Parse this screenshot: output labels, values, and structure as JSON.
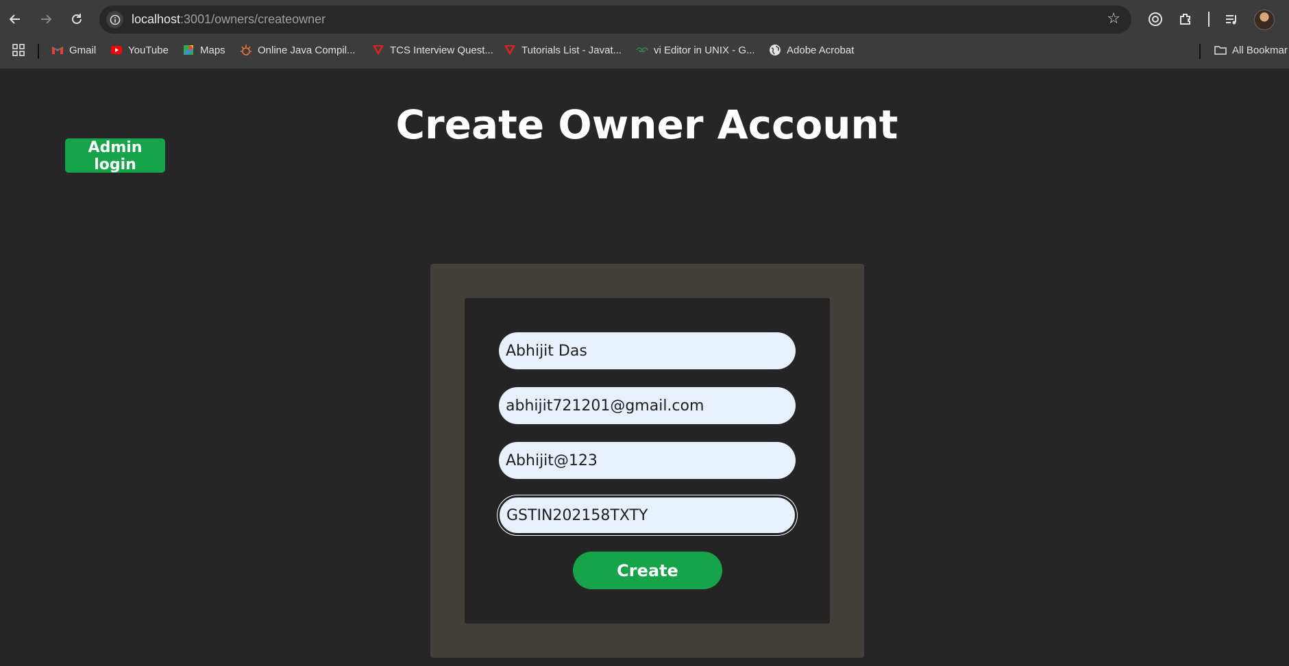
{
  "browser": {
    "url_host": "localhost",
    "url_path": ":3001/owners/createowner",
    "bookmarks": [
      {
        "label": "Gmail",
        "icon": "gmail-icon"
      },
      {
        "label": "YouTube",
        "icon": "youtube-icon"
      },
      {
        "label": "Maps",
        "icon": "maps-icon"
      },
      {
        "label": "Online Java Compil...",
        "icon": "java-compiler-icon"
      },
      {
        "label": "TCS Interview Quest...",
        "icon": "javatpoint-icon"
      },
      {
        "label": "Tutorials List - Javat...",
        "icon": "javatpoint-icon"
      },
      {
        "label": "vi Editor in UNIX - G...",
        "icon": "geeksforgeeks-icon"
      },
      {
        "label": "Adobe Acrobat",
        "icon": "globe-icon"
      }
    ],
    "all_bookmarks_label": "All Bookmar"
  },
  "page": {
    "title": "Create Owner Account",
    "admin_login_label": "Admin login",
    "form": {
      "name_value": "Abhijit Das",
      "email_value": "abhijit721201@gmail.com",
      "password_value": "Abhijit@123",
      "gstin_value": "GSTIN202158TXTY",
      "submit_label": "Create"
    }
  },
  "colors": {
    "accent_green": "#16a34a",
    "page_bg": "#262626",
    "outer_box": "#433f39",
    "input_bg": "#e8f0fe"
  }
}
